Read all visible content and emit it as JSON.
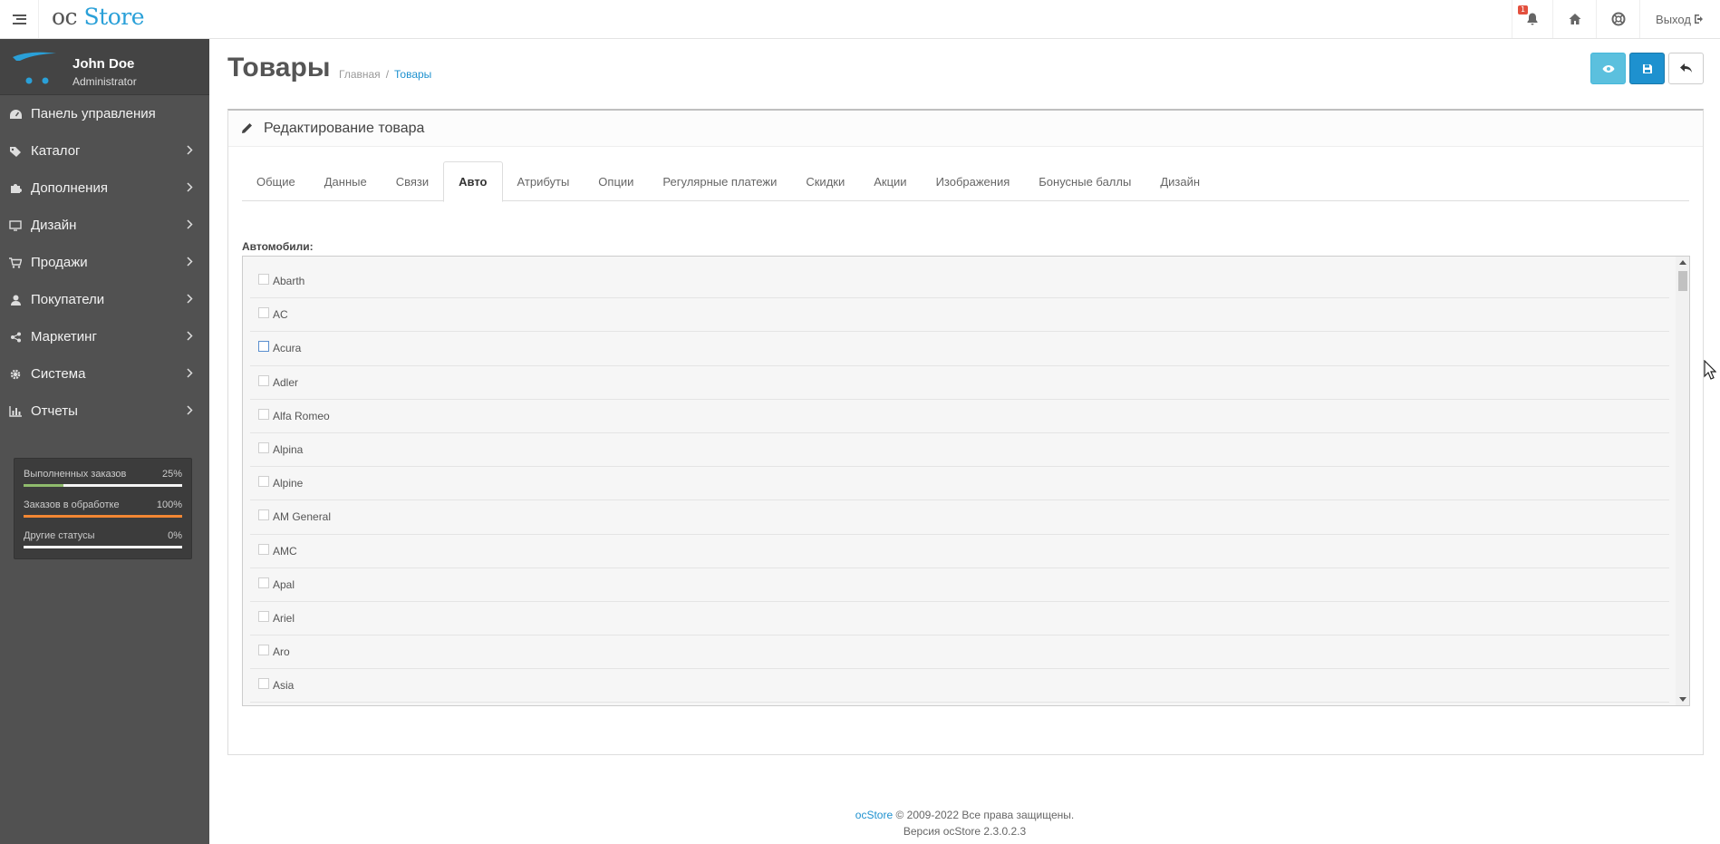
{
  "header": {
    "logo_prefix": "oc",
    "logo_brand": "Store",
    "notification_count": "1",
    "logout_label": "Выход"
  },
  "profile": {
    "name": "John Doe",
    "role": "Administrator"
  },
  "sidebar": {
    "items": [
      {
        "label": "Панель управления",
        "icon": "dashboard-icon",
        "has_children": false
      },
      {
        "label": "Каталог",
        "icon": "tags-icon",
        "has_children": true
      },
      {
        "label": "Дополнения",
        "icon": "puzzle-icon",
        "has_children": true
      },
      {
        "label": "Дизайн",
        "icon": "monitor-icon",
        "has_children": true
      },
      {
        "label": "Продажи",
        "icon": "cart-icon",
        "has_children": true
      },
      {
        "label": "Покупатели",
        "icon": "user-icon",
        "has_children": true
      },
      {
        "label": "Маркетинг",
        "icon": "share-icon",
        "has_children": true
      },
      {
        "label": "Система",
        "icon": "gear-icon",
        "has_children": true
      },
      {
        "label": "Отчеты",
        "icon": "bar-chart-icon",
        "has_children": true
      }
    ]
  },
  "stats": [
    {
      "label": "Выполненных заказов",
      "value": "25%",
      "progress": 0.25,
      "color": "#8fbb6c"
    },
    {
      "label": "Заказов в обработке",
      "value": "100%",
      "progress": 1.0,
      "color": "#f38733"
    },
    {
      "label": "Другие статусы",
      "value": "0%",
      "progress": 0.0,
      "color": "#1e91cf"
    }
  ],
  "page": {
    "title": "Товары",
    "breadcrumb": [
      "Главная",
      "Товары"
    ]
  },
  "panel": {
    "title": "Редактирование товара"
  },
  "tabs": [
    {
      "label": "Общие",
      "active": false
    },
    {
      "label": "Данные",
      "active": false
    },
    {
      "label": "Связи",
      "active": false
    },
    {
      "label": "Авто",
      "active": true
    },
    {
      "label": "Атрибуты",
      "active": false
    },
    {
      "label": "Опции",
      "active": false
    },
    {
      "label": "Регулярные платежи",
      "active": false
    },
    {
      "label": "Скидки",
      "active": false
    },
    {
      "label": "Акции",
      "active": false
    },
    {
      "label": "Изображения",
      "active": false
    },
    {
      "label": "Бонусные баллы",
      "active": false
    },
    {
      "label": "Дизайн",
      "active": false
    }
  ],
  "cars": {
    "label": "Автомобили:",
    "items": [
      "Abarth",
      "AC",
      "Acura",
      "Adler",
      "Alfa Romeo",
      "Alpina",
      "Alpine",
      "AM General",
      "AMC",
      "Apal",
      "Ariel",
      "Aro",
      "Asia"
    ],
    "checked": [
      false,
      false,
      false,
      false,
      false,
      false,
      false,
      false,
      false,
      false,
      false,
      false,
      false
    ]
  },
  "footer": {
    "brand": "ocStore",
    "copyright": "© 2009-2022 Все права защищены.",
    "version": "Версия ocStore 2.3.0.2.3"
  },
  "colors": {
    "accent": "#1e91cf",
    "info_button": "#5bc0de",
    "sidebar_bg": "#515151"
  }
}
